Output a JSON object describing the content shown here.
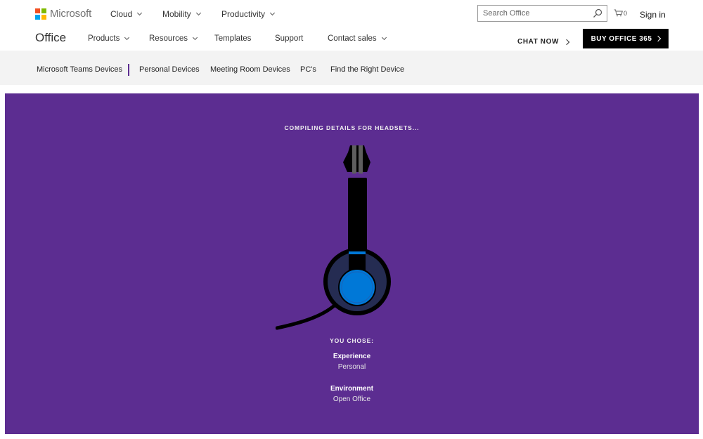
{
  "header": {
    "brand": "Microsoft",
    "logo_colors": [
      "#f25022",
      "#7fba00",
      "#00a4ef",
      "#ffb900"
    ],
    "nav": [
      {
        "label": "Cloud"
      },
      {
        "label": "Mobility"
      },
      {
        "label": "Productivity"
      }
    ],
    "search_placeholder": "Search Office",
    "cart_count": "0",
    "sign_in": "Sign in"
  },
  "office_bar": {
    "title": "Office",
    "nav": [
      {
        "label": "Products"
      },
      {
        "label": "Resources"
      },
      {
        "label": "Templates"
      },
      {
        "label": "Support"
      },
      {
        "label": "Contact sales"
      }
    ],
    "chat_label": "CHAT NOW",
    "buy_label": "BUY OFFICE 365"
  },
  "subnav": {
    "items": [
      {
        "label": "Microsoft Teams Devices"
      },
      {
        "label": "Personal Devices"
      },
      {
        "label": "Meeting Room Devices"
      },
      {
        "label": "PC's"
      },
      {
        "label": "Find the Right Device"
      }
    ]
  },
  "hero": {
    "background": "#5c2d91",
    "compiling_text": "COMPILING DETAILS FOR HEADSETS...",
    "you_chose_label": "YOU CHOSE:",
    "choices": [
      {
        "label": "Experience",
        "value": "Personal"
      },
      {
        "label": "Environment",
        "value": "Open Office"
      }
    ]
  }
}
